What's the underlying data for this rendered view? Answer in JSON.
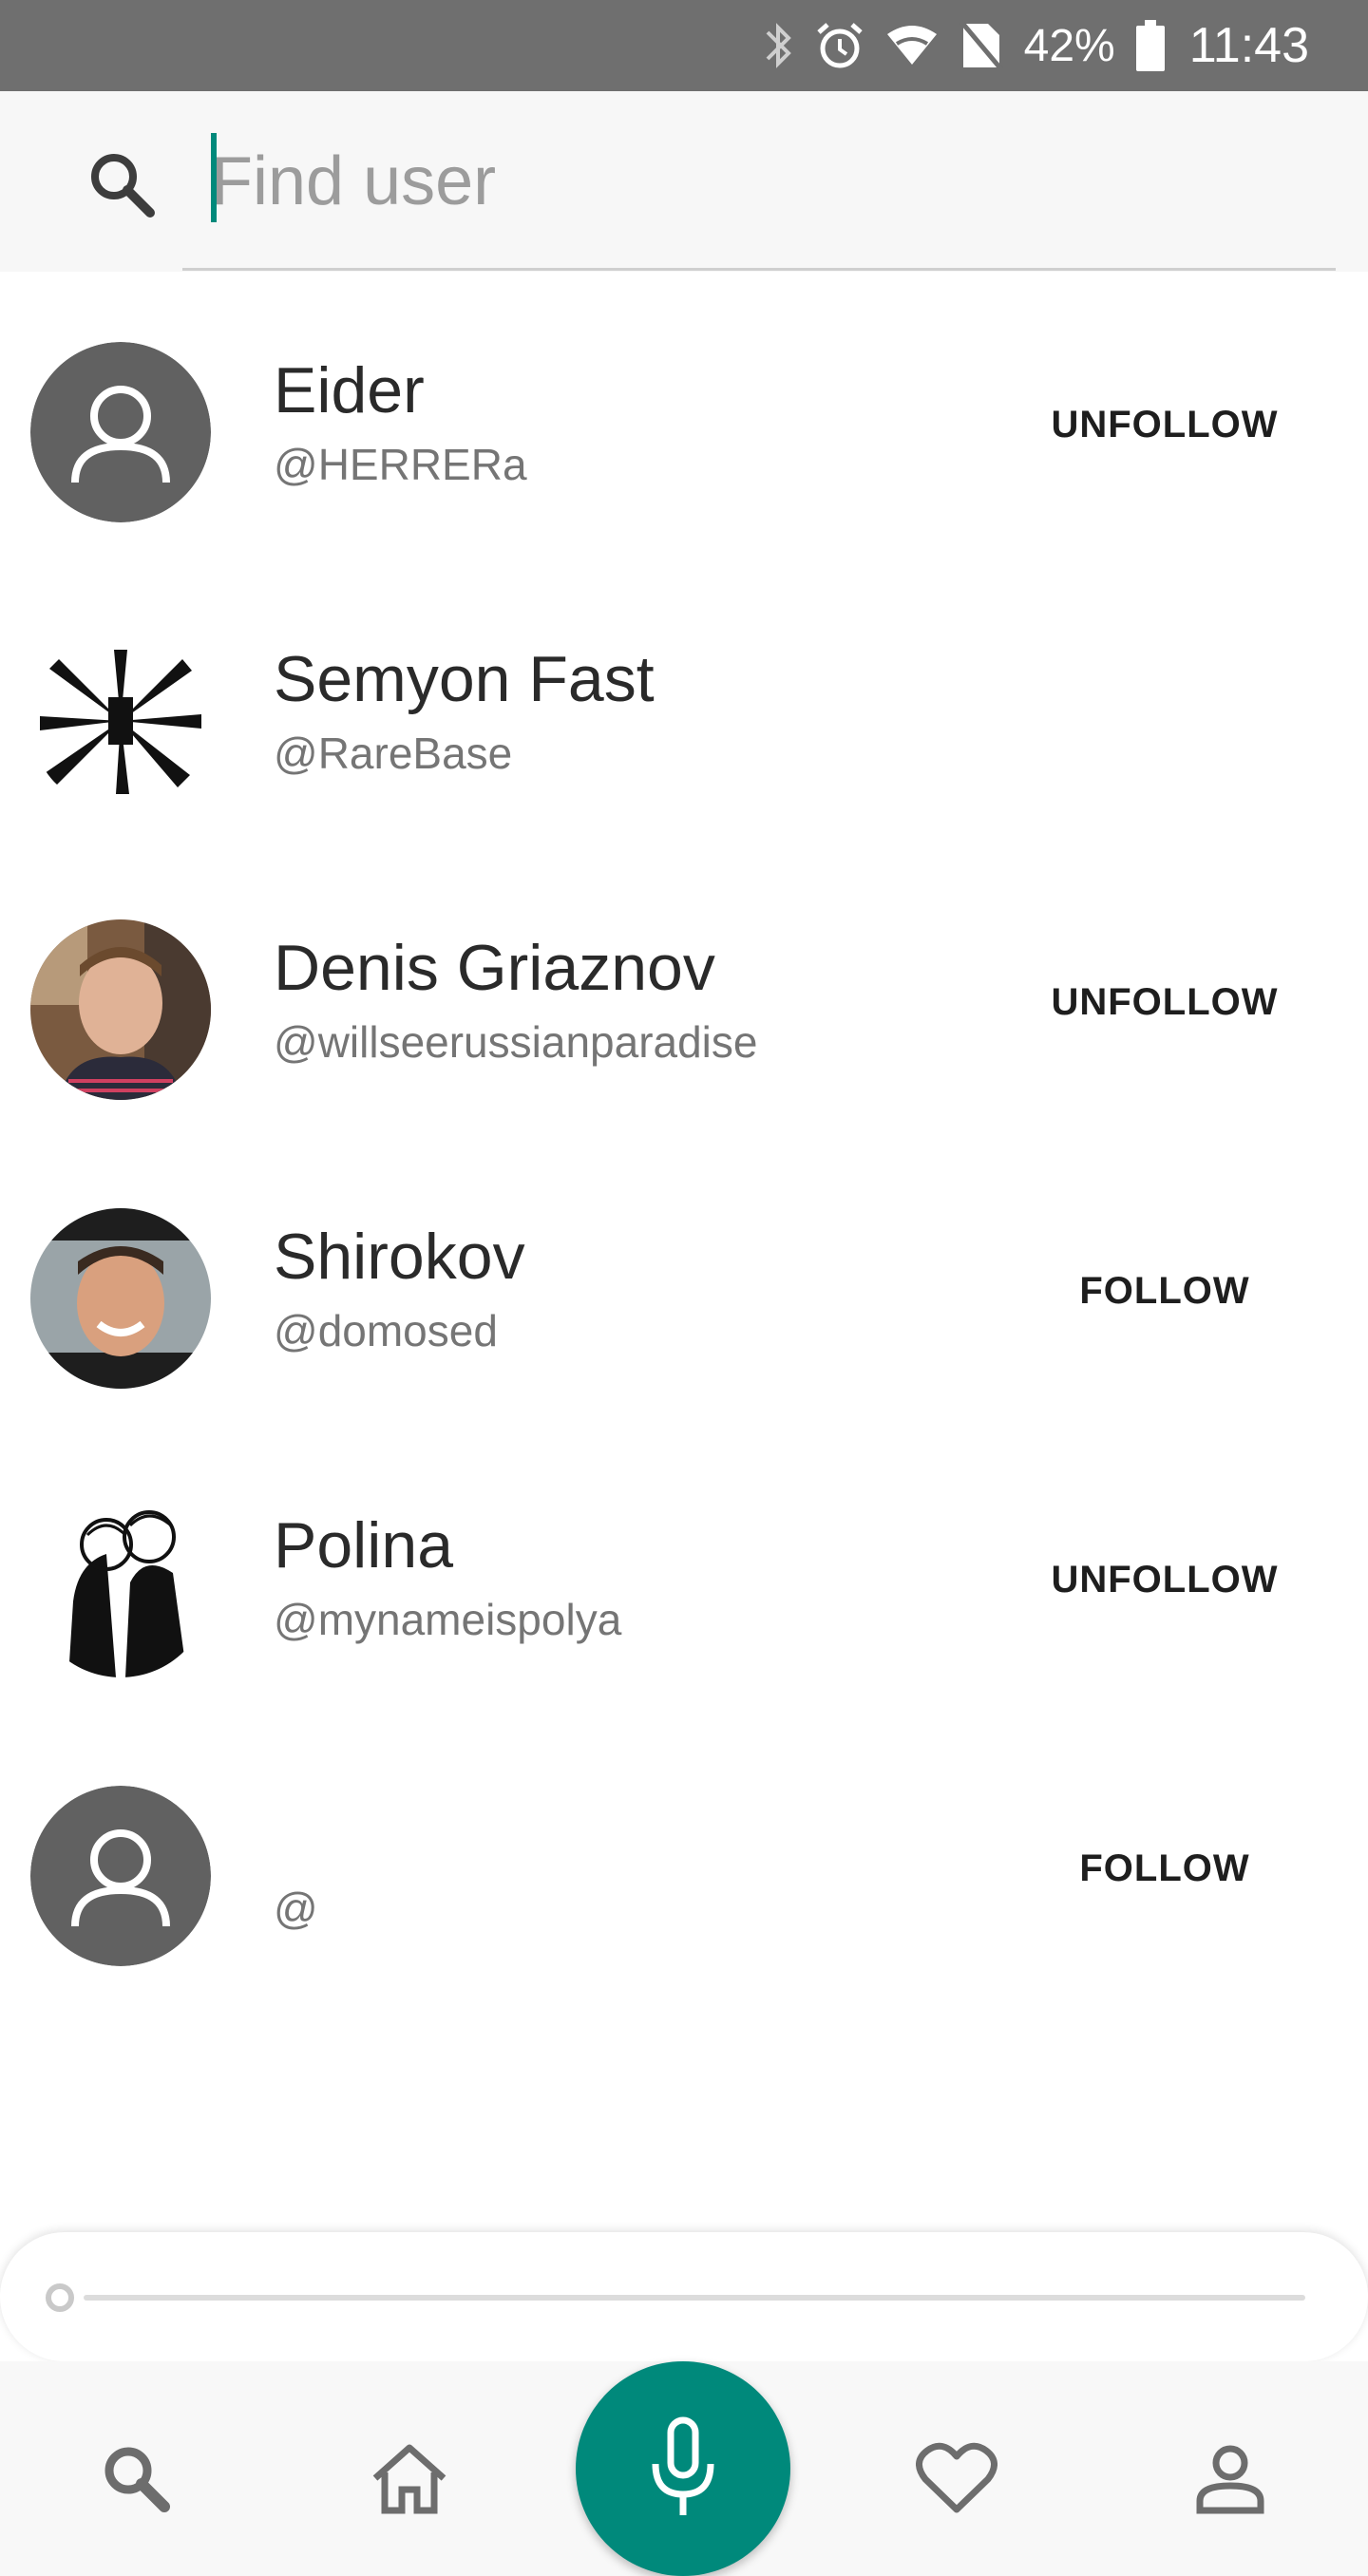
{
  "status_bar": {
    "battery_percent": "42%",
    "time": "11:43",
    "icons": [
      "bluetooth-icon",
      "alarm-icon",
      "wifi-icon",
      "no-sim-icon",
      "battery-icon"
    ]
  },
  "search": {
    "placeholder": "Find user",
    "value": ""
  },
  "users": [
    {
      "name": "Eider",
      "handle": "@HERRERa",
      "action": "UNFOLLOW",
      "avatar": "default-avatar"
    },
    {
      "name": "Semyon Fast",
      "handle": "@RareBase",
      "action": "",
      "avatar": "photo-avatar"
    },
    {
      "name": "Denis Griaznov",
      "handle": "@willseerussianparadise",
      "action": "UNFOLLOW",
      "avatar": "photo-avatar"
    },
    {
      "name": "Shirokov",
      "handle": "@domosed",
      "action": "FOLLOW",
      "avatar": "photo-avatar"
    },
    {
      "name": "Polina",
      "handle": "@mynameispolya",
      "action": "UNFOLLOW",
      "avatar": "photo-avatar"
    },
    {
      "name": "",
      "handle": "@",
      "action": "FOLLOW",
      "avatar": "default-avatar"
    }
  ],
  "player": {
    "progress": 0
  },
  "bottom_nav": {
    "items": [
      "search-icon",
      "home-icon",
      "microphone-icon",
      "heart-icon",
      "profile-icon"
    ]
  },
  "colors": {
    "accent": "#00897b",
    "status_bar": "#6f6f6f",
    "default_avatar": "#616161"
  }
}
